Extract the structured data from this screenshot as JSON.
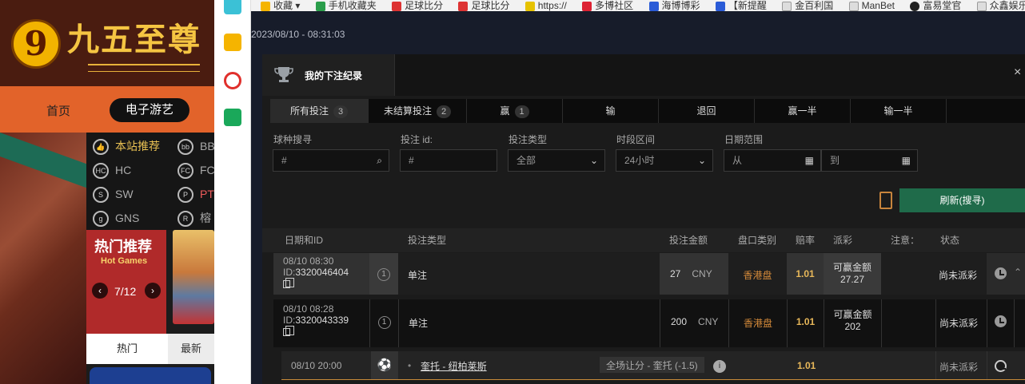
{
  "site": {
    "logo_mark": "9",
    "logo_text": "九五至尊",
    "nav": {
      "home": "首页",
      "games": "电子游艺"
    },
    "providers": [
      {
        "label": "本站推荐",
        "icon": "thumbs-up-icon",
        "glyph": "👍"
      },
      {
        "label": "BB",
        "icon": "bb-logo-icon",
        "glyph": "bb"
      },
      {
        "label": "HC",
        "icon": "hc-logo-icon",
        "glyph": "HC"
      },
      {
        "label": "FC",
        "icon": "fc-logo-icon",
        "glyph": "FC"
      },
      {
        "label": "SW",
        "icon": "sw-logo-icon",
        "glyph": "S"
      },
      {
        "label": "PT",
        "icon": "pt-logo-icon",
        "glyph": "P"
      },
      {
        "label": "GNS",
        "icon": "gns-logo-icon",
        "glyph": "g"
      },
      {
        "label": "榕",
        "icon": "ron-logo-icon",
        "glyph": "R"
      }
    ],
    "hot": {
      "title": "热门推荐",
      "subtitle": "Hot Games",
      "page": "7/12"
    },
    "bottom_tabs": {
      "hot": "热门",
      "latest": "最新"
    }
  },
  "bookmarks": [
    "收藏",
    "手机收藏夹",
    "足球比分",
    "足球比分",
    "https://",
    "多博社区",
    "海博博彩",
    "【新提醒",
    "金百利国",
    "ManBet",
    "富易堂官",
    "众鑫娱乐"
  ],
  "page": {
    "timestamp": "2023/08/10 - 08:31:03"
  },
  "modal": {
    "title": "我的下注纪录",
    "close": "×",
    "tabs": [
      {
        "label": "所有投注",
        "count": "3",
        "active": true
      },
      {
        "label": "未结算投注",
        "count": "2",
        "active": false
      },
      {
        "label": "赢",
        "count": "1",
        "active": false
      },
      {
        "label": "输",
        "count": "",
        "active": false
      },
      {
        "label": "退回",
        "count": "",
        "active": false
      },
      {
        "label": "赢一半",
        "count": "",
        "active": false
      },
      {
        "label": "输一半",
        "count": "",
        "active": false
      }
    ],
    "filters": {
      "sport_search": {
        "label": "球种搜寻",
        "placeholder": "#"
      },
      "bet_id": {
        "label": "投注 id:",
        "placeholder": "#"
      },
      "bet_type": {
        "label": "投注类型",
        "value": "全部"
      },
      "time_range": {
        "label": "时段区间",
        "value": "24小时"
      },
      "date_range": {
        "label": "日期范围",
        "from": "从",
        "to": "到"
      }
    },
    "refresh_label": "刷新(搜寻)",
    "columns": [
      "日期和ID",
      "投注类型",
      "投注金额",
      "盘口类别",
      "赔率",
      "派彩",
      "注意：",
      "状态"
    ],
    "rows": [
      {
        "date": "08/10 08:30",
        "id_prefix": "ID:",
        "id": "3320046404",
        "index": "1",
        "type": "单注",
        "amount": "27",
        "currency": "CNY",
        "market": "香港盘",
        "odds": "1.01",
        "payout_label": "可赢金额",
        "payout": "27.27",
        "status": "尚未派彩"
      },
      {
        "date": "08/10 08:28",
        "id_prefix": "ID:",
        "id": "3320043339",
        "index": "1",
        "type": "单注",
        "amount": "200",
        "currency": "CNY",
        "market": "香港盘",
        "odds": "1.01",
        "payout_label": "可赢金额",
        "payout": "202",
        "status": "尚未派彩"
      }
    ],
    "sub_row": {
      "date": "08/10 20:00",
      "match": "奎托 - 纽柏莱斯",
      "selection": "全场让分 - 奎托 (-1.5)",
      "odds": "1.01",
      "status": "尚未派彩"
    }
  },
  "colors": {
    "accent_green": "#1f6b4a",
    "gold": "#e8b85a",
    "nav_orange": "#e2632a",
    "hot_red": "#b02a2a"
  }
}
